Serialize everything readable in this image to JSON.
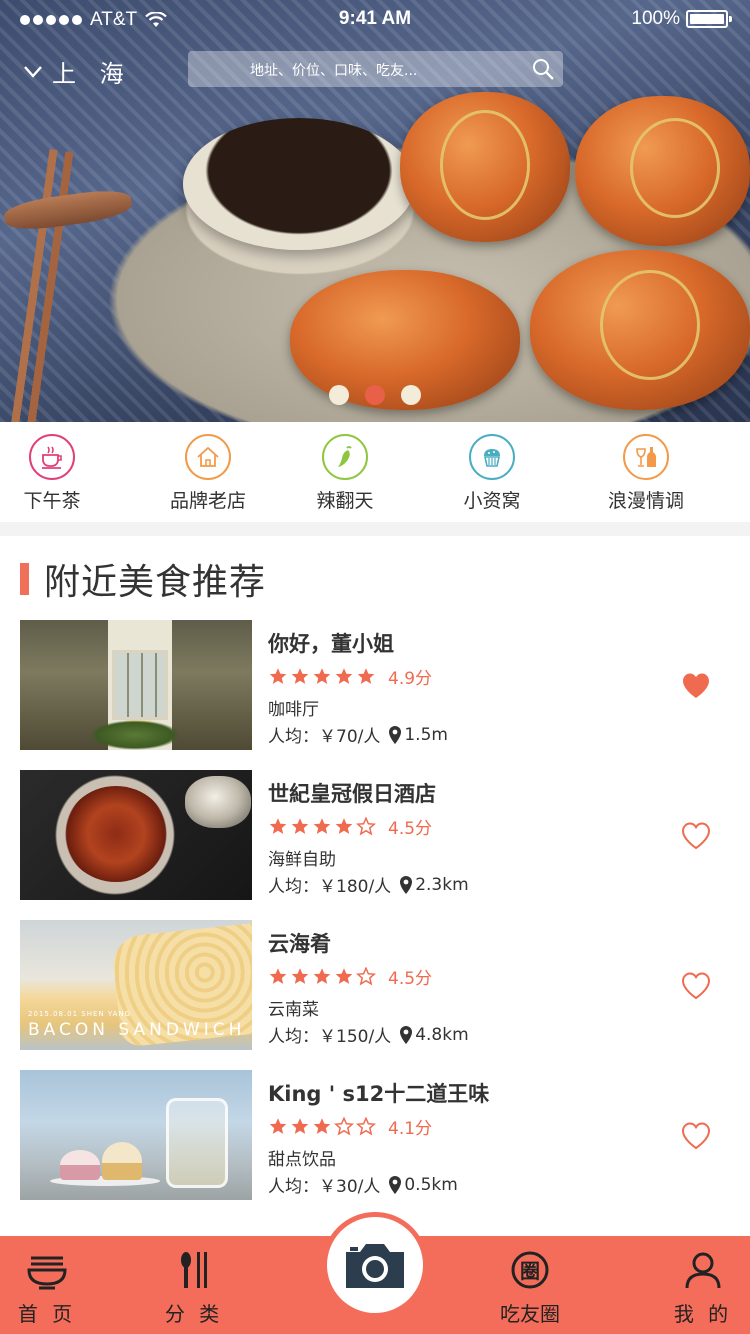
{
  "status_bar": {
    "carrier": "AT&T",
    "time": "9:41 AM",
    "battery": "100%"
  },
  "header": {
    "city": "上 海",
    "search_placeholder": "地址、价位、口味、吃友..."
  },
  "carousel": {
    "page_count": 3,
    "active_index": 1
  },
  "categories": [
    {
      "label": "下午茶",
      "icon": "tea-cup-icon",
      "color": "#e0407a"
    },
    {
      "label": "品牌老店",
      "icon": "house-icon",
      "color": "#f39a4a"
    },
    {
      "label": "辣翻天",
      "icon": "chili-icon",
      "color": "#8fc640"
    },
    {
      "label": "小资窝",
      "icon": "cupcake-icon",
      "color": "#4aaec2"
    },
    {
      "label": "浪漫情调",
      "icon": "wine-icon",
      "color": "#f39a4a"
    }
  ],
  "section": {
    "title": "附近美食推荐"
  },
  "restaurants": [
    {
      "name": "你好，董小姐",
      "stars": 5,
      "score": "4.9分",
      "type": "咖啡厅",
      "price": "人均：￥70/人",
      "distance": "1.5m",
      "favorited": true
    },
    {
      "name": "世紀皇冠假日酒店",
      "stars": 4,
      "score": "4.5分",
      "type": "海鲜自助",
      "price": "人均：￥180/人",
      "distance": "2.3km",
      "favorited": false
    },
    {
      "name": "云海肴",
      "stars": 4,
      "score": "4.5分",
      "type": "云南菜",
      "price": "人均：￥150/人",
      "distance": "4.8km",
      "favorited": false,
      "thumb_text": "BACON SANDWICH",
      "thumb_small_text": "2015.08.01 SHEN YANG"
    },
    {
      "name": "King ' s12十二道王味",
      "stars": 3,
      "score": "4.1分",
      "type": "甜点饮品",
      "price": "人均：￥30/人",
      "distance": "0.5km",
      "favorited": false
    }
  ],
  "tabbar": {
    "home": "首 页",
    "category": "分 类",
    "camera": "camera-icon",
    "friends": "吃友圈",
    "friends_glyph": "圈",
    "me": "我 的"
  },
  "colors": {
    "accent": "#f06a4f",
    "tabbar": "#f46d5b",
    "camera": "#2c3e4d"
  }
}
